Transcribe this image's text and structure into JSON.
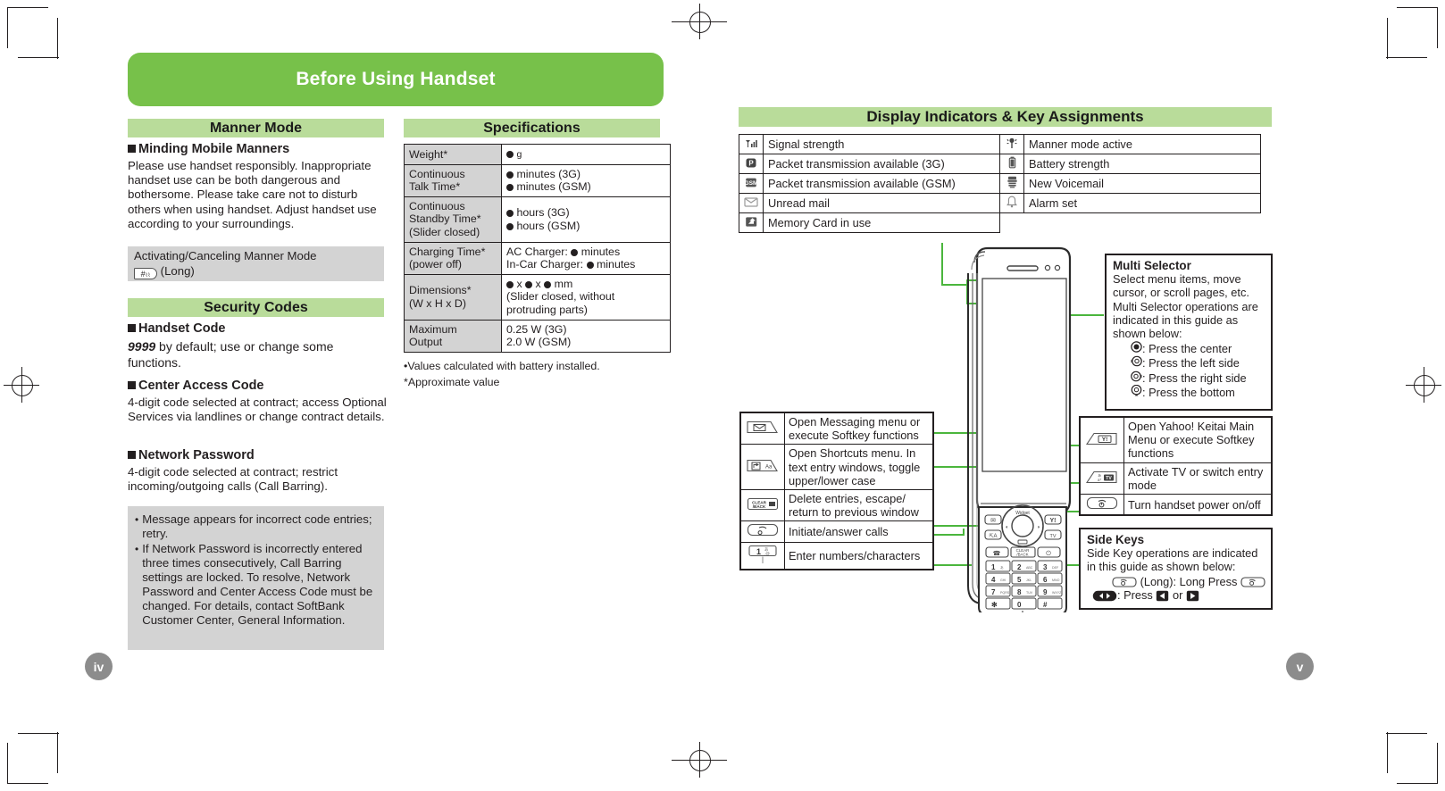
{
  "document": {
    "banner_title": "Before Using Handset",
    "page_left": "iv",
    "page_right": "v"
  },
  "manner_mode": {
    "heading": "Manner Mode",
    "sub_heading": "Minding Mobile Manners",
    "body": "Please use handset responsibly. Inappropriate handset use can be both dangerous and bothersome. Please take care not to disturb others when using handset. Adjust handset use according to your surroundings.",
    "note_title": "Activating/Canceling Manner Mode",
    "note_key_label": "#",
    "note_key_suffix": "(Long)"
  },
  "security_codes": {
    "heading": "Security Codes",
    "items": [
      {
        "title": "Handset Code",
        "value": "9999",
        "body": " by default; use or change some functions."
      },
      {
        "title": "Center Access Code",
        "body": "4-digit code selected at contract; access Optional Services via landlines or change contract details."
      },
      {
        "title": "Network Password",
        "body": "4-digit code selected at contract; restrict incoming/outgoing calls (Call Barring)."
      }
    ],
    "notes": [
      "Message appears for incorrect code entries; retry.",
      "If Network Password is incorrectly entered three times consecutively, Call Barring settings are locked. To resolve, Network Password and Center Access Code must be changed. For details, contact SoftBank Customer Center, General Information."
    ]
  },
  "specifications": {
    "heading": "Specifications",
    "rows": [
      {
        "key": "Weight*",
        "values": [
          "● g"
        ]
      },
      {
        "key": "Continuous\nTalk Time*",
        "values": [
          "● minutes (3G)",
          "● minutes (GSM)"
        ]
      },
      {
        "key": "Continuous\nStandby Time*\n(Slider closed)",
        "values": [
          "● hours (3G)",
          "● hours (GSM)"
        ]
      },
      {
        "key": "Charging Time*\n(power off)",
        "values": [
          "AC Charger: ● minutes",
          "In-Car Charger: ● minutes"
        ]
      },
      {
        "key": "Dimensions*\n(W x H x D)",
        "values": [
          "● x ● x ● mm",
          "(Slider closed, without",
          "protruding parts)"
        ]
      },
      {
        "key": "Maximum\nOutput",
        "values": [
          "0.25 W (3G)",
          "2.0 W (GSM)"
        ]
      }
    ],
    "footnotes": [
      "Values calculated with battery installed.",
      "*Approximate value"
    ]
  },
  "display_indicators": {
    "heading": "Display Indicators & Key Assignments",
    "left_column": [
      {
        "icon": "signal-strength-icon",
        "label": "Signal strength"
      },
      {
        "icon": "packet-3g-icon",
        "label": "Packet transmission available (3G)"
      },
      {
        "icon": "packet-gsm-icon",
        "label": "Packet transmission available (GSM)"
      },
      {
        "icon": "unread-mail-icon",
        "label": "Unread mail"
      },
      {
        "icon": "memory-card-icon",
        "label": "Memory Card in use"
      }
    ],
    "right_column": [
      {
        "icon": "manner-mode-icon",
        "label": "Manner mode active"
      },
      {
        "icon": "battery-icon",
        "label": "Battery strength"
      },
      {
        "icon": "voicemail-icon",
        "label": "New Voicemail"
      },
      {
        "icon": "alarm-icon",
        "label": "Alarm set"
      }
    ]
  },
  "key_assignments_left": [
    {
      "key_icon": "mail-softkey-icon",
      "desc": "Open Messaging menu or execute Softkey functions"
    },
    {
      "key_icon": "shortcuts-key-icon",
      "desc": "Open Shortcuts menu. In text entry windows, toggle upper/lower case"
    },
    {
      "key_icon": "clear-back-key-icon",
      "key_label": "CLEAR\n/BACK",
      "desc": "Delete entries, escape/ return to previous window"
    },
    {
      "key_icon": "call-key-icon",
      "desc": "Initiate/answer calls"
    },
    {
      "key_icon": "keypad-key-icon",
      "key_label": "1",
      "desc": "Enter numbers/characters"
    }
  ],
  "key_assignments_right": [
    {
      "key_icon": "yahoo-key-icon",
      "key_label": "Y!",
      "desc": "Open Yahoo! Keitai Main Menu or execute Softkey functions"
    },
    {
      "key_icon": "tv-key-icon",
      "desc": "Activate TV or switch entry mode"
    },
    {
      "key_icon": "power-key-icon",
      "desc": "Turn handset power on/off"
    }
  ],
  "multi_selector": {
    "title": "Multi Selector",
    "body": "Select menu items, move cursor, or scroll pages, etc. Multi Selector operations are indicated in this guide as shown below:",
    "items": [
      {
        "icon": "multiselector-center-icon",
        "label": ": Press the center"
      },
      {
        "icon": "multiselector-left-icon",
        "label": ": Press the left side"
      },
      {
        "icon": "multiselector-right-icon",
        "label": ": Press the right side"
      },
      {
        "icon": "multiselector-bottom-icon",
        "label": ": Press the bottom"
      }
    ]
  },
  "side_keys": {
    "title": "Side Keys",
    "body": "Side Key operations are indicated in this guide as shown below:",
    "line1_mid": "(Long): Long Press",
    "line2_mid": ": Press",
    "line2_or": "or"
  },
  "colors": {
    "banner_green": "#77c14a",
    "section_green": "#b9dc9a",
    "callout_green": "#4bb63d",
    "grey_box": "#d3d3d3",
    "page_bubble": "#8c8c8c"
  }
}
